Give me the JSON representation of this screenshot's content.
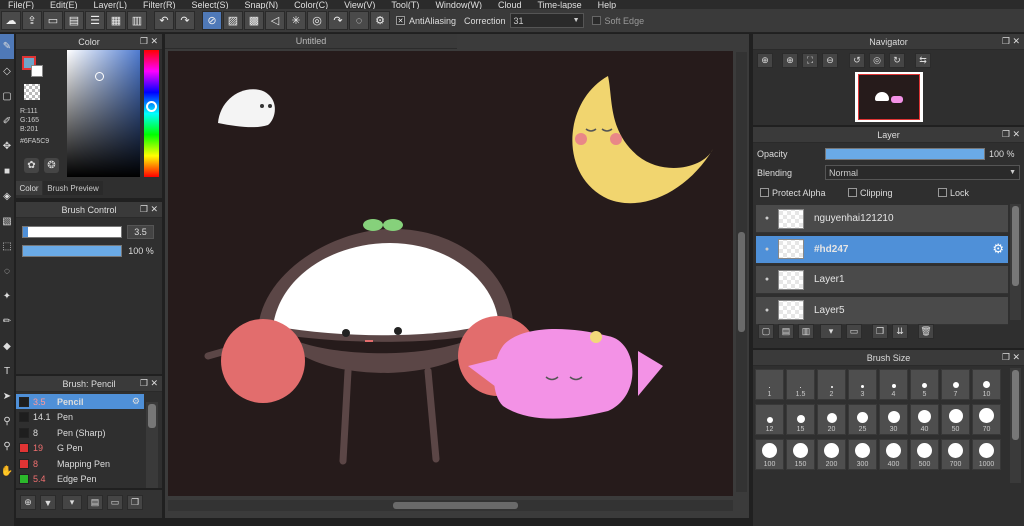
{
  "menu": [
    "File(F)",
    "Edit(E)",
    "Layer(L)",
    "Filter(R)",
    "Select(S)",
    "Snap(N)",
    "Color(C)",
    "View(V)",
    "Tool(T)",
    "Window(W)",
    "Cloud",
    "Time-lapse",
    "Help"
  ],
  "toolbar": {
    "antialiasing_label": "AntiAliasing",
    "correction_label": "Correction",
    "correction_value": "31",
    "soft_edge_label": "Soft Edge"
  },
  "color_panel": {
    "title": "Color",
    "r": "R:111",
    "g": "G:165",
    "b": "B:201",
    "hex": "#6FA5C9",
    "tab_color": "Color",
    "tab_preview": "Brush Preview",
    "current_color": "#6FA5C9"
  },
  "brush_control": {
    "title": "Brush Control",
    "size_value": "3.5",
    "opacity_value": "100 %",
    "size_fraction": 0.05,
    "opacity_fraction": 1.0
  },
  "brush_list": {
    "title": "Brush: Pencil",
    "items": [
      {
        "size": "3.5",
        "name": "Pencil",
        "color": "#1e1e1e",
        "selected": true
      },
      {
        "size": "14.1",
        "name": "Pen",
        "color": "#1e1e1e",
        "selected": false
      },
      {
        "size": "8",
        "name": "Pen (Sharp)",
        "color": "#1e1e1e",
        "selected": false
      },
      {
        "size": "19",
        "name": "G Pen",
        "color": "#e03434",
        "selected": false
      },
      {
        "size": "8",
        "name": "Mapping Pen",
        "color": "#e03434",
        "selected": false
      },
      {
        "size": "5.4",
        "name": "Edge Pen",
        "color": "#2bb82b",
        "selected": false
      }
    ]
  },
  "canvas": {
    "tab_title": "Untitled"
  },
  "navigator": {
    "title": "Navigator"
  },
  "layer_panel": {
    "title": "Layer",
    "opacity_label": "Opacity",
    "opacity_value": "100 %",
    "opacity_fraction": 1.0,
    "blending_label": "Blending",
    "blending_value": "Normal",
    "protect_alpha_label": "Protect Alpha",
    "clipping_label": "Clipping",
    "lock_label": "Lock",
    "layers": [
      {
        "name": "nguyenhai121210",
        "selected": false
      },
      {
        "name": "#hd247",
        "selected": true
      },
      {
        "name": "Layer1",
        "selected": false
      },
      {
        "name": "Layer5",
        "selected": false
      }
    ]
  },
  "brush_size_panel": {
    "title": "Brush Size",
    "sizes": [
      "1",
      "1.5",
      "2",
      "3",
      "4",
      "5",
      "7",
      "10",
      "12",
      "15",
      "20",
      "25",
      "30",
      "40",
      "50",
      "70",
      "100",
      "150",
      "200",
      "300",
      "400",
      "500",
      "700",
      "1000"
    ]
  }
}
